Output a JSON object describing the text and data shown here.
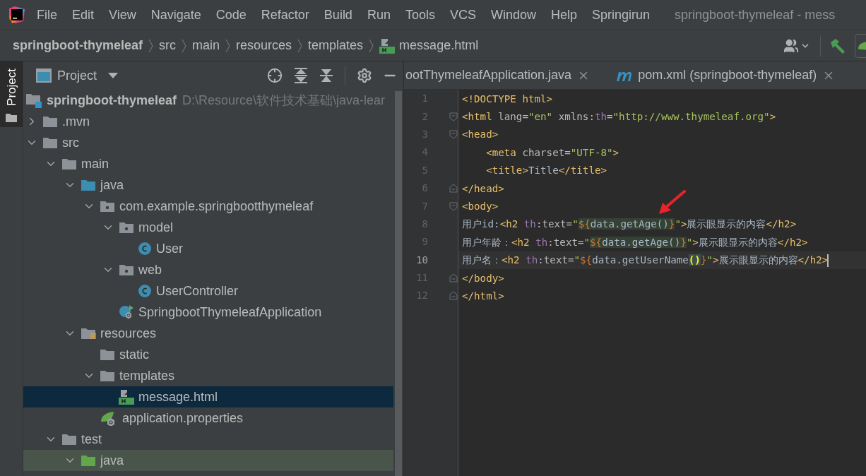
{
  "menu": [
    {
      "label": "File"
    },
    {
      "label": "Edit"
    },
    {
      "label": "View"
    },
    {
      "label": "Navigate"
    },
    {
      "label": "Code"
    },
    {
      "label": "Refactor"
    },
    {
      "label": "Build"
    },
    {
      "label": "Run"
    },
    {
      "label": "Tools"
    },
    {
      "label": "VCS"
    },
    {
      "label": "Window"
    },
    {
      "label": "Help"
    },
    {
      "label": "Springirun"
    }
  ],
  "window": {
    "title": "springboot-thymeleaf - mess"
  },
  "breadcrumb": [
    {
      "label": "springboot-thymeleaf",
      "kind": "project"
    },
    {
      "label": "src",
      "kind": "folder"
    },
    {
      "label": "main",
      "kind": "folder"
    },
    {
      "label": "resources",
      "kind": "folder"
    },
    {
      "label": "templates",
      "kind": "folder"
    },
    {
      "label": "message.html",
      "kind": "html"
    }
  ],
  "side_strip": {
    "tab": {
      "label": "Project",
      "selected": true
    }
  },
  "project_panel": {
    "title": "Project",
    "tree": [
      {
        "name": "springboot-thymeleaf",
        "path": "D:\\Resource\\软件技术基础\\java-lear",
        "kind": "module",
        "selected": false,
        "children": [
          {
            "name": ".mvn",
            "kind": "folder",
            "expanded": false,
            "selected": false
          },
          {
            "name": "src",
            "kind": "folder",
            "expanded": true,
            "selected": false,
            "children": [
              {
                "name": "main",
                "kind": "folder",
                "expanded": true,
                "selected": false,
                "children": [
                  {
                    "name": "java",
                    "kind": "source",
                    "expanded": true,
                    "selected": false,
                    "children": [
                      {
                        "name": "com.example.springbootthymeleaf",
                        "kind": "package",
                        "expanded": true,
                        "selected": false,
                        "children": [
                          {
                            "name": "model",
                            "kind": "package",
                            "expanded": true,
                            "selected": false,
                            "children": [
                              {
                                "name": "User",
                                "kind": "class",
                                "selected": false
                              }
                            ]
                          },
                          {
                            "name": "web",
                            "kind": "package",
                            "expanded": true,
                            "selected": false,
                            "children": [
                              {
                                "name": "UserController",
                                "kind": "class",
                                "selected": false
                              }
                            ]
                          },
                          {
                            "name": "SpringbootThymeleafApplication",
                            "kind": "spring-class",
                            "selected": false
                          }
                        ]
                      }
                    ]
                  },
                  {
                    "name": "resources",
                    "kind": "resources",
                    "expanded": true,
                    "selected": false,
                    "children": [
                      {
                        "name": "static",
                        "kind": "folder",
                        "selected": false
                      },
                      {
                        "name": "templates",
                        "kind": "folder",
                        "expanded": true,
                        "selected": false,
                        "children": [
                          {
                            "name": "message.html",
                            "kind": "html",
                            "selected": true
                          }
                        ]
                      },
                      {
                        "name": "application.properties",
                        "kind": "spring-props",
                        "selected": false
                      }
                    ]
                  }
                ]
              },
              {
                "name": "test",
                "kind": "folder",
                "expanded": true,
                "selected": false,
                "children": [
                  {
                    "name": "java",
                    "kind": "test-source",
                    "expanded": true,
                    "selected": false
                  }
                ]
              }
            ]
          }
        ]
      }
    ]
  },
  "editor": {
    "tabs": [
      {
        "label": "ootThymeleafApplication.java",
        "kind": "java"
      },
      {
        "label": "pom.xml (springboot-thymeleaf)",
        "kind": "maven"
      }
    ],
    "lines": [
      {
        "number": "1",
        "fold_start": false,
        "fold_end": false,
        "current": false,
        "tokens": [
          {
            "t": "<!DOCTYPE html>",
            "kind": "tag"
          }
        ]
      },
      {
        "number": "2",
        "fold_start": true,
        "fold_end": false,
        "current": false,
        "tokens": [
          {
            "t": "<html ",
            "kind": "tag"
          },
          {
            "t": "lang=",
            "kind": "attr"
          },
          {
            "t": "\"en\"",
            "kind": "string"
          },
          {
            "t": " xmlns:",
            "kind": "attr"
          },
          {
            "t": "th",
            "kind": "ns"
          },
          {
            "t": "=",
            "kind": "attr"
          },
          {
            "t": "\"http://www.thymeleaf.org\"",
            "kind": "string"
          },
          {
            "t": ">",
            "kind": "tag"
          }
        ]
      },
      {
        "number": "3",
        "fold_start": true,
        "fold_end": false,
        "current": false,
        "tokens": [
          {
            "t": "<head>",
            "kind": "tag"
          }
        ]
      },
      {
        "number": "4",
        "fold_start": false,
        "fold_end": false,
        "current": false,
        "tokens": [
          {
            "t": "    <meta ",
            "kind": "tag"
          },
          {
            "t": "charset=",
            "kind": "attr"
          },
          {
            "t": "\"UTF-8\"",
            "kind": "string"
          },
          {
            "t": ">",
            "kind": "tag"
          }
        ]
      },
      {
        "number": "5",
        "fold_start": false,
        "fold_end": false,
        "current": false,
        "tokens": [
          {
            "t": "    <title>",
            "kind": "tag"
          },
          {
            "t": "Title",
            "kind": "text"
          },
          {
            "t": "</title>",
            "kind": "tag"
          }
        ]
      },
      {
        "number": "6",
        "fold_start": false,
        "fold_end": true,
        "current": false,
        "tokens": [
          {
            "t": "</head>",
            "kind": "tag"
          }
        ]
      },
      {
        "number": "7",
        "fold_start": true,
        "fold_end": false,
        "current": false,
        "tokens": [
          {
            "t": "<body>",
            "kind": "tag"
          }
        ]
      },
      {
        "number": "8",
        "fold_start": false,
        "fold_end": false,
        "current": false,
        "tokens": [
          {
            "t": "用户id:",
            "kind": "text"
          },
          {
            "t": "<h2 ",
            "kind": "tag"
          },
          {
            "t": "th",
            "kind": "ns"
          },
          {
            "t": ":text=",
            "kind": "attr"
          },
          {
            "t": "\"",
            "kind": "string"
          },
          {
            "t": "${",
            "kind": "hl-brace"
          },
          {
            "t": "data.getAge()",
            "kind": "hl-expr"
          },
          {
            "t": "}",
            "kind": "hl-brace"
          },
          {
            "t": "\"",
            "kind": "string"
          },
          {
            "t": ">",
            "kind": "tag"
          },
          {
            "t": "展示眼显示的内容",
            "kind": "text"
          },
          {
            "t": "</h2>",
            "kind": "tag"
          }
        ]
      },
      {
        "number": "9",
        "fold_start": false,
        "fold_end": false,
        "current": false,
        "tokens": [
          {
            "t": "用户年龄：",
            "kind": "text"
          },
          {
            "t": "<h2 ",
            "kind": "tag"
          },
          {
            "t": "th",
            "kind": "ns"
          },
          {
            "t": ":text=",
            "kind": "attr"
          },
          {
            "t": "\"",
            "kind": "string"
          },
          {
            "t": "${",
            "kind": "hl-brace"
          },
          {
            "t": "data.getAge()",
            "kind": "hl-expr"
          },
          {
            "t": "}",
            "kind": "hl-brace"
          },
          {
            "t": "\"",
            "kind": "string"
          },
          {
            "t": ">",
            "kind": "tag"
          },
          {
            "t": "展示眼显示的内容",
            "kind": "text"
          },
          {
            "t": "</h2>",
            "kind": "tag"
          }
        ]
      },
      {
        "number": "10",
        "fold_start": false,
        "fold_end": false,
        "current": true,
        "tokens": [
          {
            "t": "用户名：",
            "kind": "text"
          },
          {
            "t": "<h2 ",
            "kind": "tag"
          },
          {
            "t": "th",
            "kind": "ns"
          },
          {
            "t": ":text=",
            "kind": "attr"
          },
          {
            "t": "\"",
            "kind": "string"
          },
          {
            "t": "${",
            "kind": "brace"
          },
          {
            "t": "data.getUserName",
            "kind": "expr"
          },
          {
            "t": "()",
            "kind": "paren-match"
          },
          {
            "t": "}",
            "kind": "brace"
          },
          {
            "t": "\"",
            "kind": "string"
          },
          {
            "t": ">",
            "kind": "tag"
          },
          {
            "t": "展示眼显示的内容",
            "kind": "text"
          },
          {
            "t": "</h2>",
            "kind": "tag"
          }
        ]
      },
      {
        "number": "11",
        "fold_start": false,
        "fold_end": true,
        "current": false,
        "tokens": [
          {
            "t": "</body>",
            "kind": "tag"
          }
        ]
      },
      {
        "number": "12",
        "fold_start": false,
        "fold_end": true,
        "current": false,
        "tokens": [
          {
            "t": "</html>",
            "kind": "tag"
          }
        ]
      }
    ]
  }
}
